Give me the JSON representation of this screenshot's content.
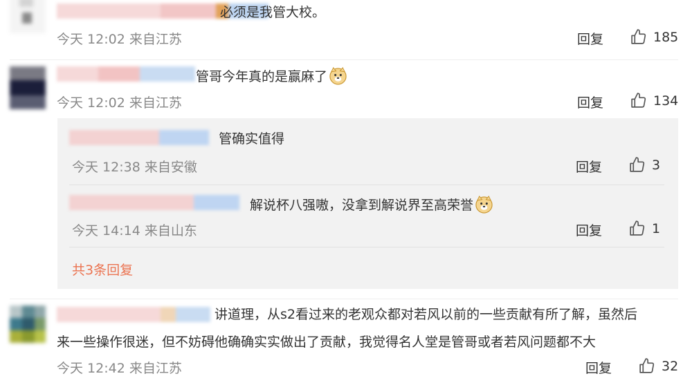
{
  "comments": [
    {
      "text": "必须是我管大校。",
      "meta": "今天 12:02 来自江苏",
      "reply_label": "回复",
      "likes": "185"
    },
    {
      "text": "管哥今年真的是赢麻了",
      "meta": "今天 12:02 来自江苏",
      "reply_label": "回复",
      "likes": "134",
      "replies": [
        {
          "text": "管确实值得",
          "meta": "今天 12:38 来自安徽",
          "reply_label": "回复",
          "likes": "3"
        },
        {
          "text": "解说杯八强嗷，没拿到解说界至高荣誉",
          "meta": "今天 14:14 来自山东",
          "reply_label": "回复",
          "likes": "1"
        }
      ],
      "more_replies": "共3条回复"
    },
    {
      "text_line1": "讲道理，从s2看过来的老观众都对若风以前的一些贡献有所了解，虽然后",
      "text_line2": "来一些操作很迷，但不妨碍他确确实实做出了贡献，我觉得名人堂是管哥或者若风问题都不大",
      "meta": "今天 12:42 来自江苏",
      "reply_label": "回复",
      "likes": "32"
    }
  ],
  "icons": {
    "like": "thumbs-up-icon",
    "emoji": "doge-emoji-icon"
  },
  "colors": {
    "link": "#eb7350",
    "meta": "#888888",
    "sub_box": "#f2f2f2"
  }
}
